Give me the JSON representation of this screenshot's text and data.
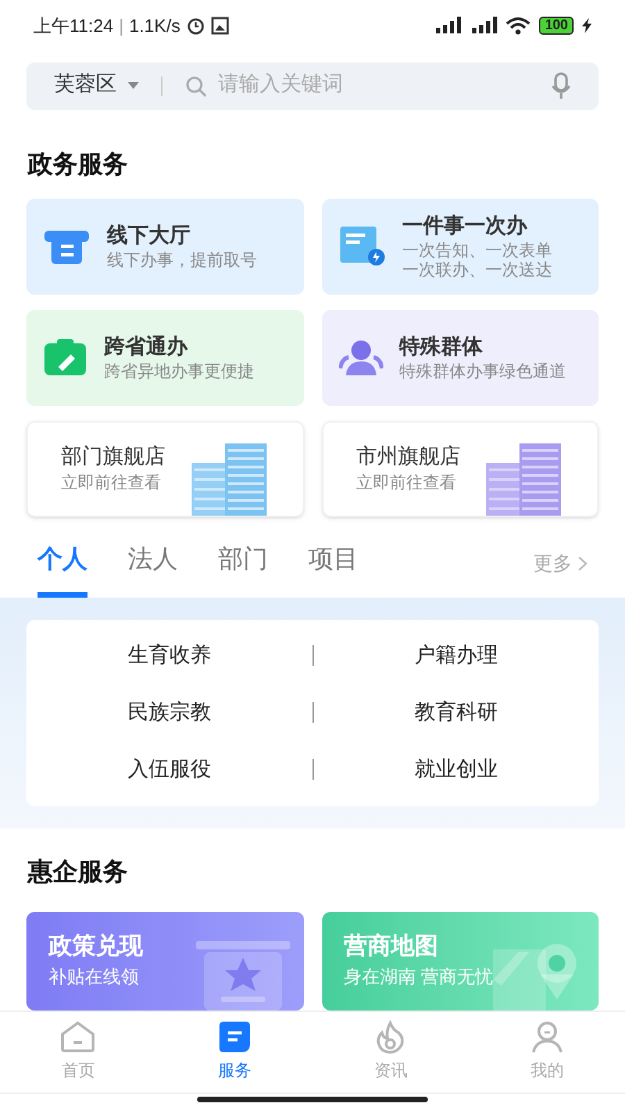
{
  "status_bar": {
    "time": "上午11:24",
    "separator": "|",
    "speed": "1.1K/s",
    "battery": "100"
  },
  "search": {
    "region": "芙蓉区",
    "placeholder": "请输入关键词"
  },
  "gov_section": {
    "title": "政务服务",
    "cards": [
      {
        "kind": "hall",
        "title": "线下大厅",
        "subtitle": [
          "线下办事，提前取号"
        ],
        "color": "#e3f0fd"
      },
      {
        "kind": "doc",
        "title": "一件事一次办",
        "subtitle": [
          "一次告知、一次表单",
          "一次联办、一次送达"
        ],
        "color": "#e3f0fd"
      },
      {
        "kind": "clipboard",
        "title": "跨省通办",
        "subtitle": [
          "跨省异地办事更便捷"
        ],
        "color": "#e6f8ea"
      },
      {
        "kind": "people",
        "title": "特殊群体",
        "subtitle": [
          "特殊群体办事绿色通道"
        ],
        "color": "#efeefc"
      }
    ],
    "stores": [
      {
        "kind": "blue",
        "title": "部门旗舰店",
        "subtitle": "立即前往查看"
      },
      {
        "kind": "purple",
        "title": "市州旗舰店",
        "subtitle": "立即前往查看"
      }
    ]
  },
  "tabs": [
    {
      "label": "个人",
      "selected": true
    },
    {
      "label": "法人",
      "selected": false
    },
    {
      "label": "部门",
      "selected": false
    },
    {
      "label": "项目",
      "selected": false
    }
  ],
  "more_link": "更多",
  "topics": [
    [
      "生育收养",
      "户籍办理"
    ],
    [
      "民族宗教",
      "教育科研"
    ],
    [
      "入伍服役",
      "就业创业"
    ]
  ],
  "biz_section": {
    "title": "惠企服务",
    "cards": [
      {
        "kind": "policy",
        "title": "政策兑现",
        "subtitle": "补贴在线领"
      },
      {
        "kind": "map",
        "title": "营商地图",
        "subtitle": "身在湖南 营商无忧"
      }
    ]
  },
  "nav": [
    {
      "kind": "home",
      "label": "首页",
      "selected": false
    },
    {
      "kind": "service",
      "label": "服务",
      "selected": true
    },
    {
      "kind": "news",
      "label": "资讯",
      "selected": false
    },
    {
      "kind": "me",
      "label": "我的",
      "selected": false
    }
  ]
}
